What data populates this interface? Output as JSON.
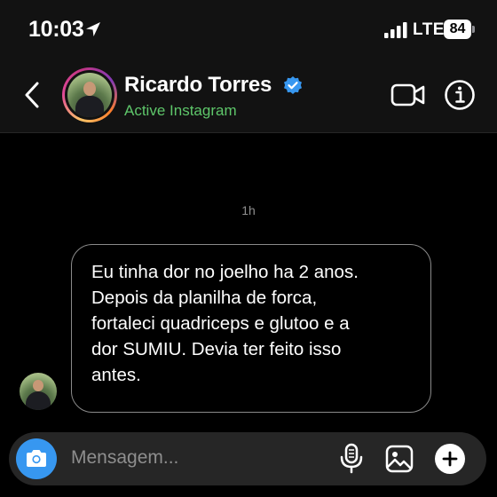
{
  "status_bar": {
    "time": "10:03",
    "network": "LTE",
    "battery": "84"
  },
  "header": {
    "contact_name": "Ricardo Torres",
    "contact_status": "Active Instagram",
    "verified": true,
    "icons": [
      "back-arrow-icon",
      "verified-badge-icon",
      "video-camera-icon",
      "info-icon"
    ],
    "colors": {
      "status_green": "#5ec66a",
      "verified_blue": "#3797f0"
    }
  },
  "chat": {
    "timestamp": "1h",
    "messages": [
      {
        "sender": "Ricardo Torres",
        "direction": "incoming",
        "lines": [
          "Eu tinha dor no joelho ha 2 anos.",
          "Depois da planilha de forca,",
          "fortaleci quadriceps e glutoo e a",
          "dor SUMIU. Devia ter feito isso",
          "antes."
        ]
      }
    ]
  },
  "composer": {
    "placeholder": "Mensagem...",
    "icons": [
      "camera-icon",
      "microphone-icon",
      "image-icon",
      "plus-icon"
    ],
    "accent": "#3797f0"
  }
}
